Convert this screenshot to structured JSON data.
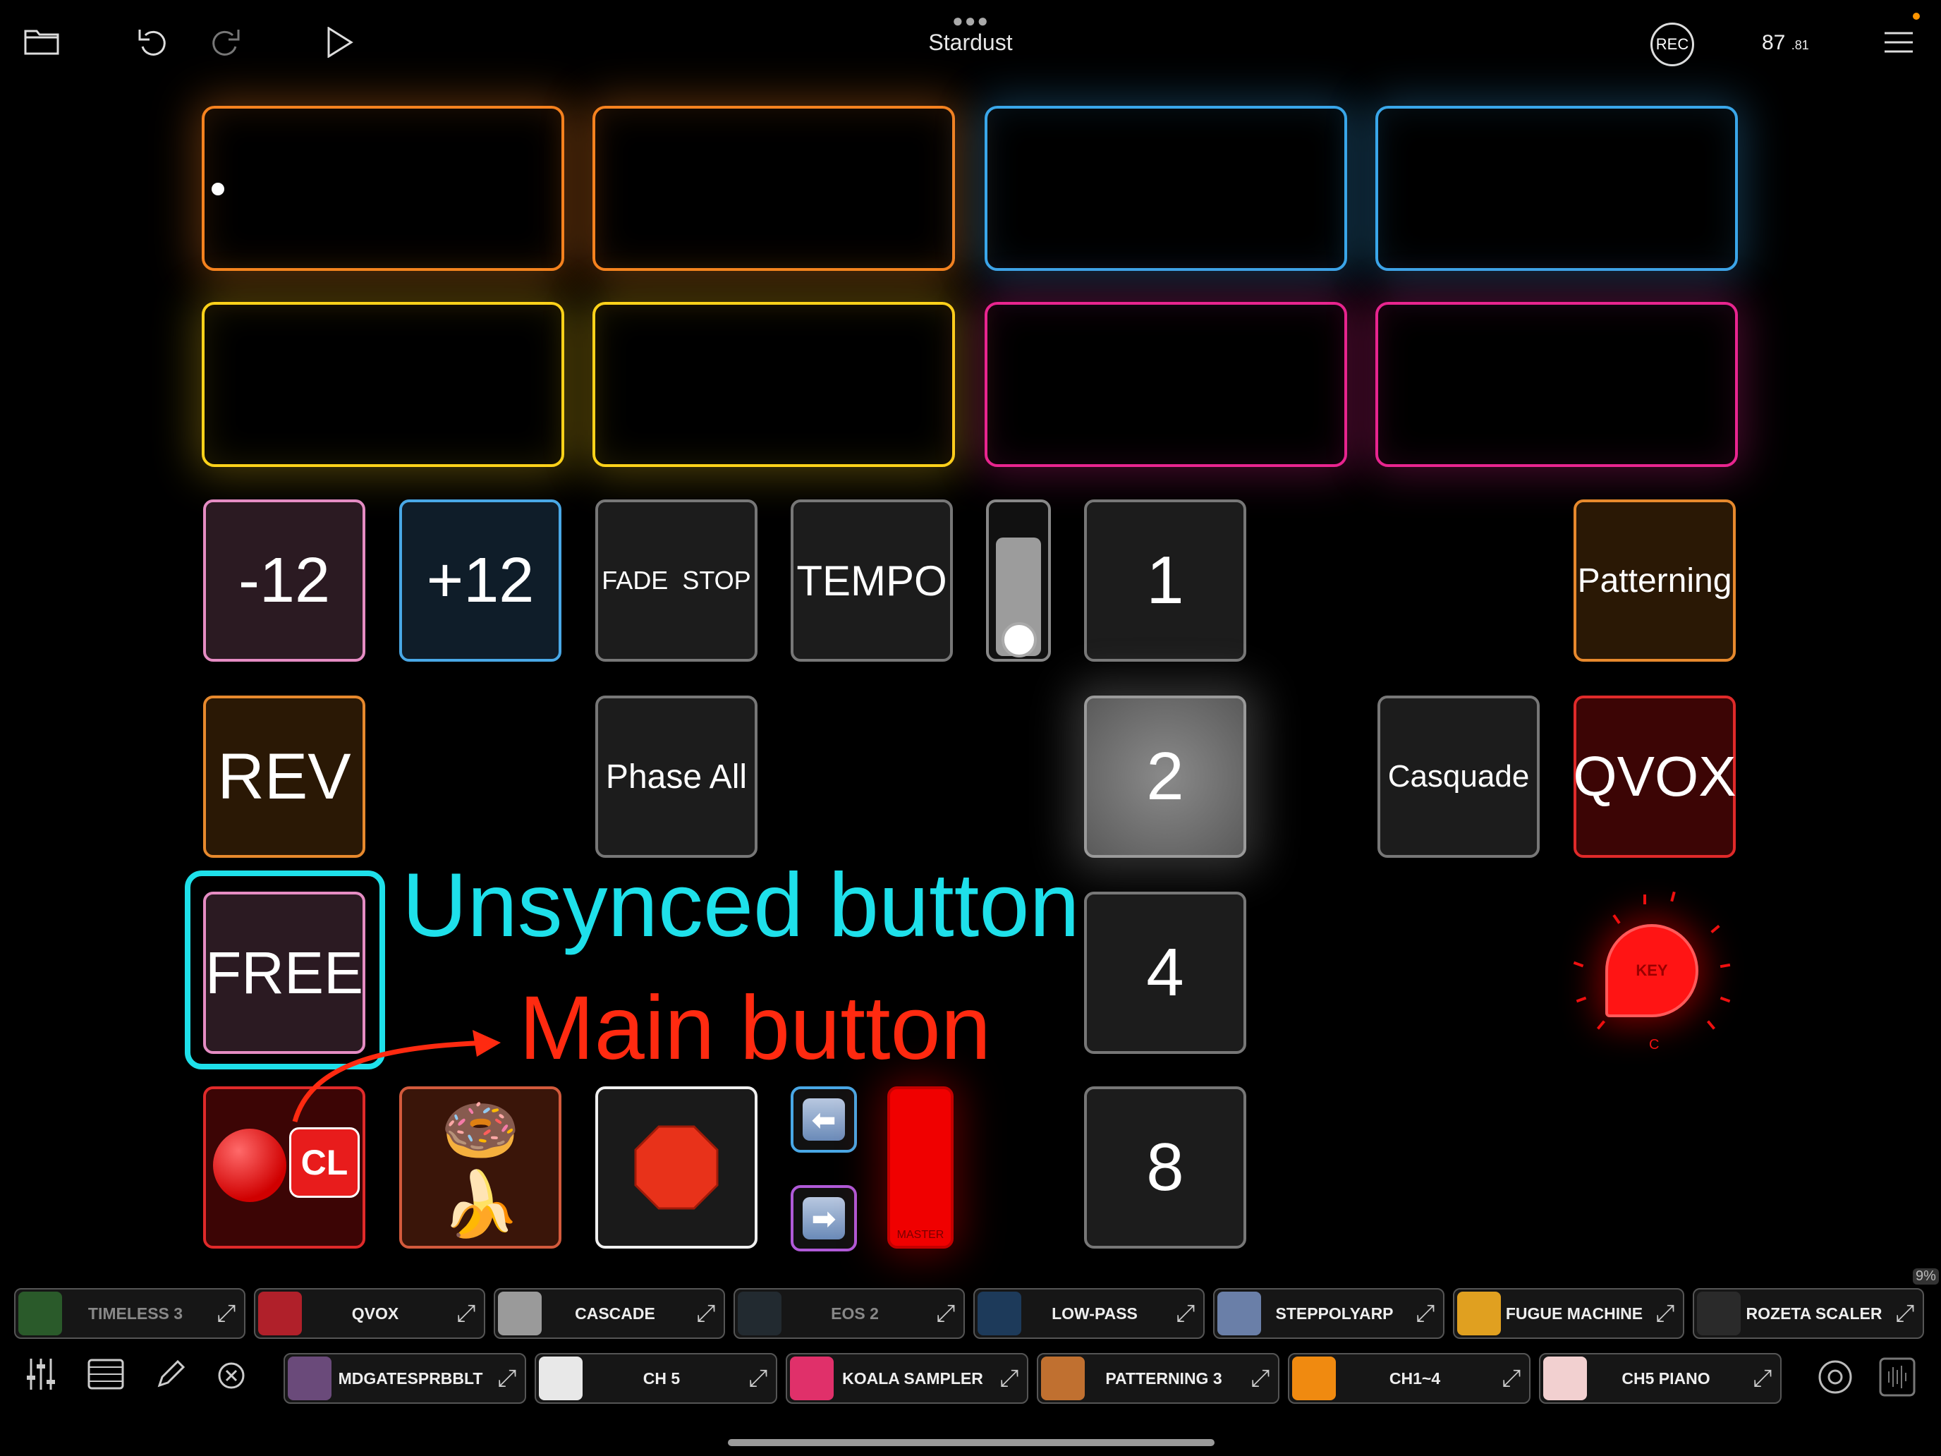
{
  "top_bar": {
    "title": "Stardust",
    "rec_label": "REC",
    "bpm": "87",
    "bpm_fraction": ".81",
    "icons": [
      "folder-icon",
      "undo-icon",
      "redo-icon",
      "play-icon",
      "more-icon",
      "menu-icon"
    ]
  },
  "pads": [
    {
      "color": "#f5821f"
    },
    {
      "color": "#f5821f"
    },
    {
      "color": "#3aa7ea"
    },
    {
      "color": "#3aa7ea"
    },
    {
      "color": "#ffd21a"
    },
    {
      "color": "#ffd21a"
    },
    {
      "color": "#e8258f"
    },
    {
      "color": "#e8258f"
    }
  ],
  "buttons": {
    "minus12": "-12",
    "plus12": "+12",
    "fade_stop": "FADE  STOP",
    "tempo": "TEMPO",
    "one": "1",
    "patterning": "Patterning",
    "rev": "REV",
    "phase_all": "Phase All",
    "two": "2",
    "casquade": "Casquade",
    "qvox": "QVOX",
    "free": "FREE",
    "four": "4",
    "eight": "8",
    "cl": "CL",
    "emoji": "🍩🍌",
    "master": "MASTER",
    "key": "KEY",
    "key_value": "C"
  },
  "annotations": {
    "unsynced": "Unsynced button",
    "main": "Main button"
  },
  "plugins_row1": [
    {
      "name": "TIMELESS 3",
      "dim": true,
      "color": "#2a5a2a"
    },
    {
      "name": "QVOX",
      "dim": false,
      "color": "#b0202a"
    },
    {
      "name": "CASCADE",
      "dim": false,
      "color": "#9a9a9a"
    },
    {
      "name": "EOS 2",
      "dim": true,
      "color": "#222a30"
    },
    {
      "name": "LOW-PASS",
      "dim": false,
      "color": "#1d3a5a"
    },
    {
      "name": "STEPPOLYARP",
      "dim": false,
      "color": "#6a7fa8"
    },
    {
      "name": "FUGUE MACHINE",
      "dim": false,
      "color": "#e0a020"
    },
    {
      "name": "ROZETA SCALER",
      "dim": false,
      "color": "#2a2a2a"
    }
  ],
  "plugins_row2": [
    {
      "name": "MDGATESPRBBLT",
      "color": "#6a4a7a"
    },
    {
      "name": "CH 5",
      "color": "#e8e8e8"
    },
    {
      "name": "KOALA SAMPLER",
      "color": "#e0306a"
    },
    {
      "name": "PATTERNING 3",
      "color": "#c07030"
    },
    {
      "name": "CH1~4",
      "color": "#f08a10"
    },
    {
      "name": "CH5 PIANO",
      "color": "#f2d0d0"
    }
  ],
  "cpu_percent": "9%",
  "bottom_icons": [
    "mixer-icon",
    "list-icon",
    "pencil-icon",
    "close-icon",
    "settings-icon",
    "waveform-icon"
  ]
}
